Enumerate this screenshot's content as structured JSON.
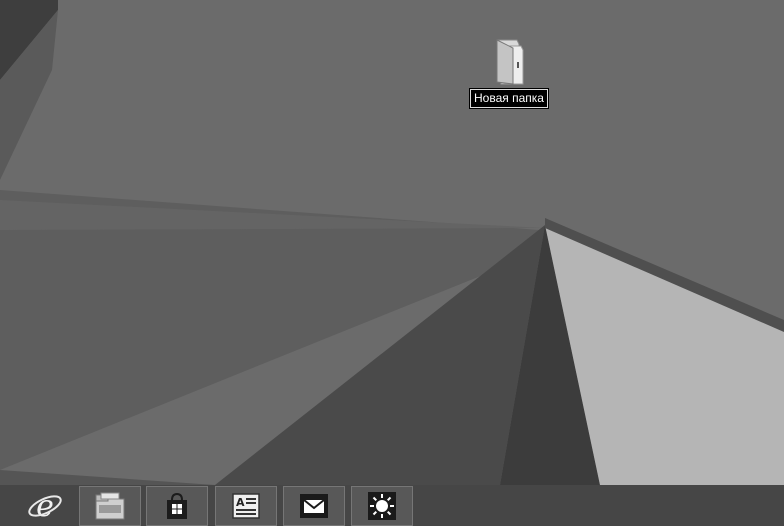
{
  "desktop": {
    "icons": [
      {
        "label": "Новая папка",
        "icon": "folder-icon",
        "selected": true
      }
    ]
  },
  "taskbar": {
    "items": [
      {
        "icon": "internet-explorer-icon",
        "active": false
      },
      {
        "icon": "file-explorer-icon",
        "active": true
      },
      {
        "icon": "store-icon",
        "active": true
      },
      {
        "icon": "news-reader-icon",
        "active": true
      },
      {
        "icon": "mail-icon",
        "active": true
      },
      {
        "icon": "weather-sun-icon",
        "active": true
      }
    ]
  },
  "colors": {
    "wallpaper_base": "#6a6a6a",
    "label_background": "#000000",
    "label_text": "#ffffff"
  }
}
